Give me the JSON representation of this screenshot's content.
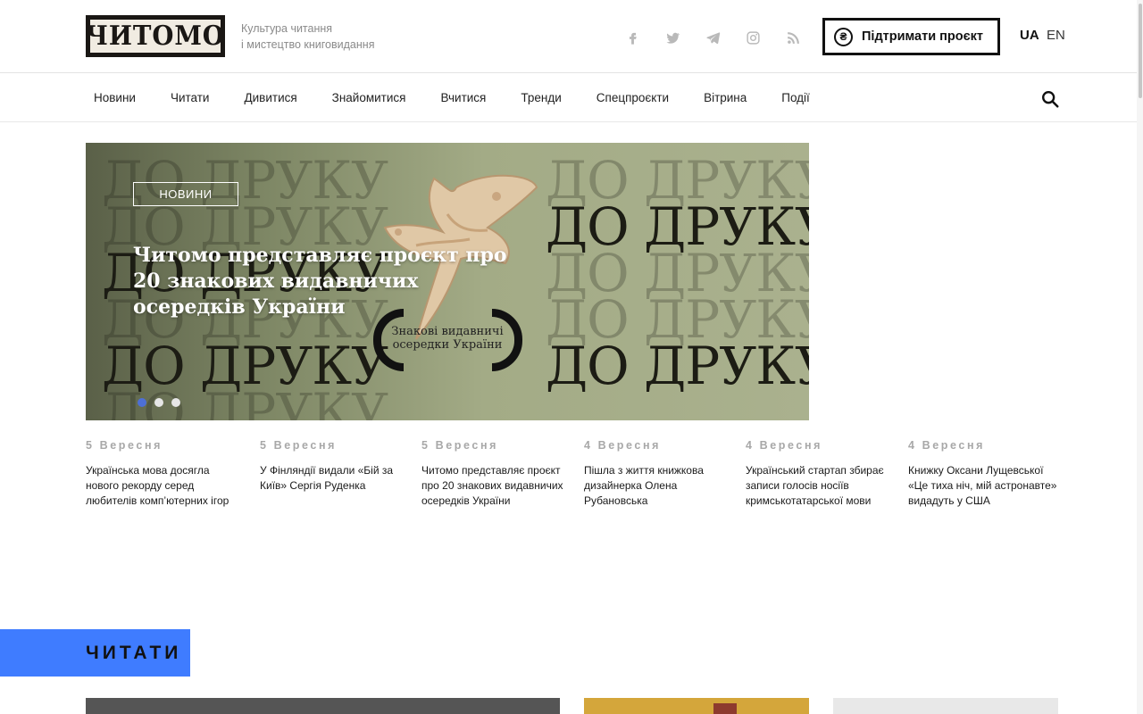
{
  "header": {
    "logo_text": "ЧИТОМО",
    "tagline_line1": "Культура читання",
    "tagline_line2": "і мистецтво книговидання",
    "socials": [
      "facebook-icon",
      "twitter-icon",
      "telegram-icon",
      "instagram-icon",
      "rss-icon"
    ],
    "support_label": "Підтримати проєкт",
    "support_icon_glyph": "₴",
    "lang_ua": "UA",
    "lang_en": "EN"
  },
  "nav": {
    "items": [
      "Новини",
      "Читати",
      "Дивитися",
      "Знайомитися",
      "Вчитися",
      "Тренди",
      "Спецпроєкти",
      "Вітрина",
      "Події"
    ]
  },
  "hero": {
    "badge": "НОВИНИ",
    "title": "Читомо представляє проєкт про 20 знакових видавничих осередків України",
    "bg_word": "ДО ДРУКУ",
    "bracket_text": "Знакові видавничі осередки України",
    "slides_total": 3,
    "active_slide": 1
  },
  "news": [
    {
      "date": "5 Вересня",
      "title": "Українська мова досягла нового рекорду серед любителів комп’ютерних ігор"
    },
    {
      "date": "5 Вересня",
      "title": "У Фінляндії видали «Бій за Київ» Сергія Руденка"
    },
    {
      "date": "5 Вересня",
      "title": "Читомо представляє проєкт про 20 знакових видавничих осередків України"
    },
    {
      "date": "4 Вересня",
      "title": "Пішла з життя книжкова дизайнерка Олена Рубановська"
    },
    {
      "date": "4 Вересня",
      "title": "Український стартап збирає записи голосів носіїв кримськотатарської мови"
    },
    {
      "date": "4 Вересня",
      "title": "Книжку Оксани Лущевської «Це тиха ніч, мій астронавте» видадуть у США"
    }
  ],
  "section": {
    "label": "ЧИТАТИ"
  },
  "colors": {
    "accent_blue": "#3f7cff",
    "active_dot": "#4d6fd6",
    "hero_green": "#a3ab86"
  }
}
